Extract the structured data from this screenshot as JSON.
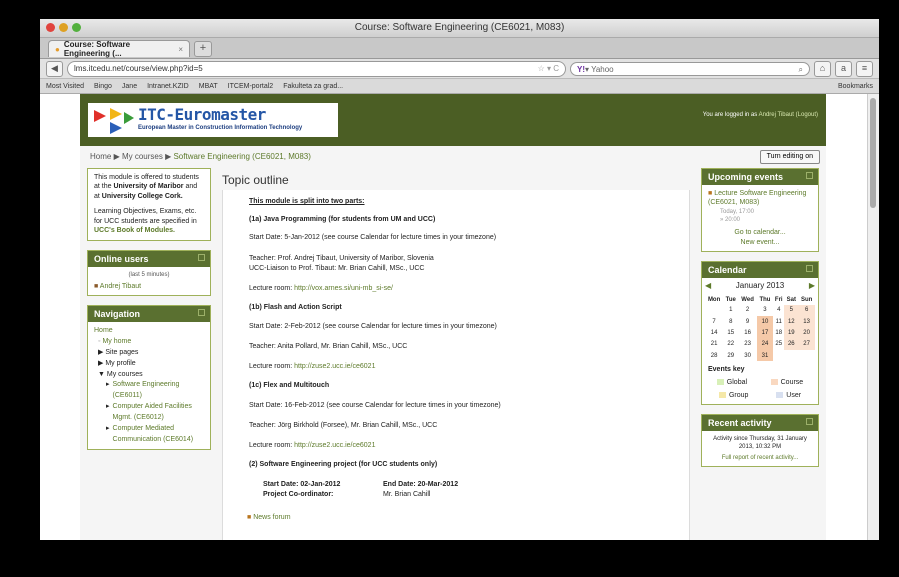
{
  "window": {
    "title": "Course: Software Engineering (CE6021, M083)"
  },
  "tabs": [
    {
      "label": "Course: Software Engineering (..."
    }
  ],
  "navbar": {
    "url": "lms.itcedu.net/course/view.php?id=5",
    "search_placeholder": "Yahoo"
  },
  "bookmarks": {
    "items": [
      "Most Visited",
      "Bingo",
      "Jane",
      "Intranet.KZID",
      "MBAT",
      "ITCEM-portal2",
      "Fakulteta za grad..."
    ],
    "right": "Bookmarks"
  },
  "header": {
    "logo_title": "ITC-Euromaster",
    "logo_sub": "European Master in Construction Information Technology",
    "logged_prefix": "You are logged in as",
    "logged_user": "Andrej Tibaut",
    "logout": "(Logout)"
  },
  "breadcrumb": {
    "home": "Home",
    "courses": "My courses",
    "course": "Software Engineering (CE6021, M083)"
  },
  "edit_button": "Turn editing on",
  "info_box": {
    "t1": "This module is offered to students at the",
    "b1": "University of Maribor",
    "t2": "and at",
    "b2": "University College Cork.",
    "t3": "Learning Objectives, Exams, etc. for UCC students are specified in",
    "link": "UCC's Book of Modules."
  },
  "online_users": {
    "title": "Online users",
    "subtitle": "(last 5 minutes)",
    "user": "Andrej Tibaut"
  },
  "navigation": {
    "title": "Navigation",
    "home": "Home",
    "my_home": "My home",
    "site_pages": "Site pages",
    "my_profile": "My profile",
    "my_courses": "My courses",
    "courses": [
      "Software Engineering (CE6011)",
      "Computer Aided Facilities Mgmt. (CE6012)",
      "Computer Mediated Communication (CE6014)"
    ]
  },
  "main": {
    "title": "Topic outline",
    "lines": [
      "This module is split into two parts:",
      "(1a) Java Programming (for students from UM and UCC)",
      "Start Date:  5-Jan-2012 (see course Calendar for lecture times in your timezone)",
      "Teacher: Prof. Andrej Tibaut, University of Maribor, Slovenia",
      "UCC-Liaison to Prof. Tibaut: Mr. Brian Cahill, MSc., UCC",
      "Lecture room:",
      "http://vox.arnes.si/uni-mb_si-se/",
      "(1b) Flash and Action Script",
      "Start Date:  2-Feb-2012 (see course Calendar for lecture times in your timezone)",
      "Teacher: Anita Pollard, Mr. Brian Cahill, MSc., UCC",
      "Lecture room:",
      "http://zuse2.ucc.ie/ce6021",
      "(1c) Flex and Multitouch",
      "Start Date:  16-Feb-2012 (see course Calendar for lecture times in your timezone)",
      "Teacher: Jörg Birkhold (Forsee), Mr. Brian Cahill, MSc., UCC",
      "Lecture room:",
      "http://zuse2.ucc.ie/ce6021",
      "(2) Software Engineering project (for UCC students only)",
      "Start Date: 02-Jan-2012",
      "End Date:  20-Mar-2012",
      "Project Co-ordinator:",
      "Mr. Brian Cahill",
      "News forum"
    ]
  },
  "upcoming": {
    "title": "Upcoming events",
    "event": "Lecture Software Engineering (CE6021, M083)",
    "time1": "Today, 17:00",
    "time2": "» 20:00",
    "goto": "Go to calendar...",
    "new_event": "New event..."
  },
  "calendar": {
    "title": "Calendar",
    "month": "January 2013",
    "days": [
      "Mon",
      "Tue",
      "Wed",
      "Thu",
      "Fri",
      "Sat",
      "Sun"
    ],
    "weeks": [
      [
        "",
        "1",
        "2",
        "3",
        "4",
        "5",
        "6"
      ],
      [
        "7",
        "8",
        "9",
        "10",
        "11",
        "12",
        "13"
      ],
      [
        "14",
        "15",
        "16",
        "17",
        "18",
        "19",
        "20"
      ],
      [
        "21",
        "22",
        "23",
        "24",
        "25",
        "26",
        "27"
      ],
      [
        "28",
        "29",
        "30",
        "31",
        "",
        "",
        ""
      ]
    ],
    "events_key": "Events key",
    "key_global": "Global",
    "key_course": "Course",
    "key_group": "Group",
    "key_user": "User"
  },
  "recent": {
    "title": "Recent activity",
    "since": "Activity since Thursday, 31 January 2013, 10:32 PM",
    "full": "Full report of recent activity..."
  },
  "colors": {
    "header": "#4b5e24",
    "block_head": "#5a7030",
    "link": "#5d7a2a"
  }
}
